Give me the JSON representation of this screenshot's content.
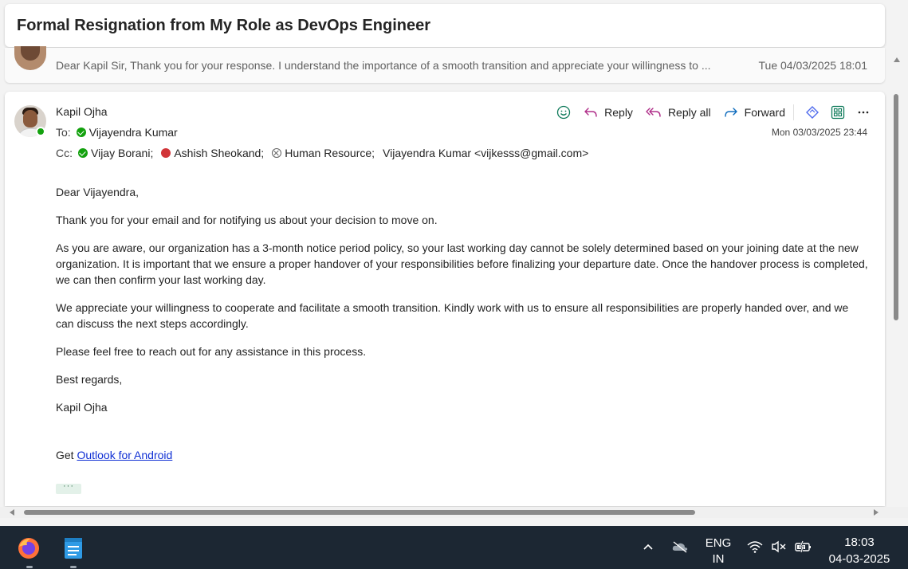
{
  "thread": {
    "subject": "Formal Resignation from My Role as DevOps Engineer"
  },
  "collapsed_message": {
    "preview": "Dear Kapil Sir, Thank you for your response. I understand the importance of a smooth transition and appreciate your willingness to ...",
    "date": "Tue 04/03/2025 18:01"
  },
  "message": {
    "sender": "Kapil Ojha",
    "to_label": "To:",
    "to": [
      {
        "name": "Vijayendra Kumar",
        "status": "available"
      }
    ],
    "cc_label": "Cc:",
    "cc": [
      {
        "name": "Vijay Borani;",
        "status": "available"
      },
      {
        "name": "Ashish Sheokand;",
        "status": "busy"
      },
      {
        "name": "Human Resource;",
        "status": "unknown"
      },
      {
        "name": "Vijayendra Kumar <vijkesss@gmail.com>",
        "status": "none"
      }
    ],
    "date": "Mon 03/03/2025 23:44",
    "actions": {
      "reply": "Reply",
      "reply_all": "Reply all",
      "forward": "Forward"
    },
    "body": {
      "greeting": "Dear Vijayendra,",
      "p1": "Thank you for your email and for notifying us about your decision to move on.",
      "p2": "As you are aware, our organization has a 3-month notice period policy, so your last working day cannot be solely determined based on your joining date at the new organization. It is important that we ensure a proper handover of your responsibilities before finalizing your departure date. Once the handover process is completed, we can then confirm your last working day.",
      "p3": "We appreciate your willingness to cooperate and facilitate a smooth transition. Kindly work with us to ensure all responsibilities are properly handed over, and we can discuss the next steps accordingly.",
      "p4": "Please feel free to reach out for any assistance in this process.",
      "closing": "Best regards,",
      "signature": "Kapil Ojha",
      "footer_prefix": "Get ",
      "footer_link": "Outlook for Android",
      "more": "···"
    }
  },
  "taskbar": {
    "language": "ENG",
    "region": "IN",
    "time": "18:03",
    "date": "04-03-2025"
  },
  "colors": {
    "accent": "#0f6cbd",
    "presence_available": "#13a10e",
    "presence_busy": "#d13438",
    "link": "#0f2fd4",
    "taskbar": "#1c2733"
  }
}
